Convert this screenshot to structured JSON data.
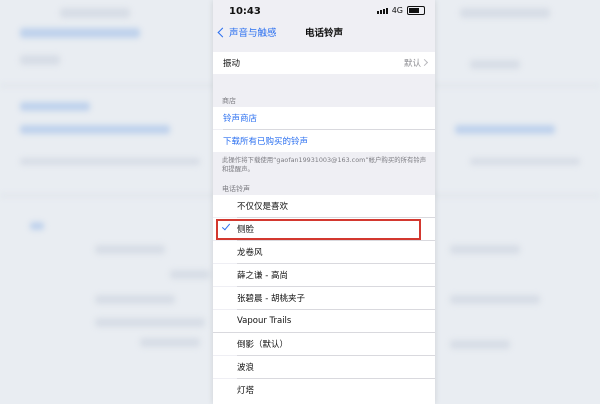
{
  "status_bar": {
    "time": "10:43",
    "network": "4G"
  },
  "nav": {
    "back_label": "声音与触感",
    "title": "电话铃声"
  },
  "vibration": {
    "label": "振动",
    "value": "默认"
  },
  "store": {
    "header": "商店",
    "tone_store": "铃声商店",
    "download_all": "下载所有已购买的铃声",
    "footer": "此操作将下载使用“gaofan19931003@163.com”帐户购买的所有铃声和提醒声。"
  },
  "ringtones": {
    "header": "电话铃声",
    "items": [
      {
        "label": "不仅仅是喜欢",
        "selected": false
      },
      {
        "label": "侧脸",
        "selected": true
      },
      {
        "label": "龙卷风",
        "selected": false
      },
      {
        "label": "薛之谦 - 高尚",
        "selected": false
      },
      {
        "label": "张碧晨 - 胡桃夹子",
        "selected": false
      },
      {
        "label": "Vapour Trails",
        "selected": false
      },
      {
        "label": "倒影（默认）",
        "selected": false
      },
      {
        "label": "波浪",
        "selected": false
      },
      {
        "label": "灯塔",
        "selected": false
      }
    ]
  },
  "colors": {
    "accent": "#2a6ff0",
    "highlight_box": "#d3382f"
  }
}
